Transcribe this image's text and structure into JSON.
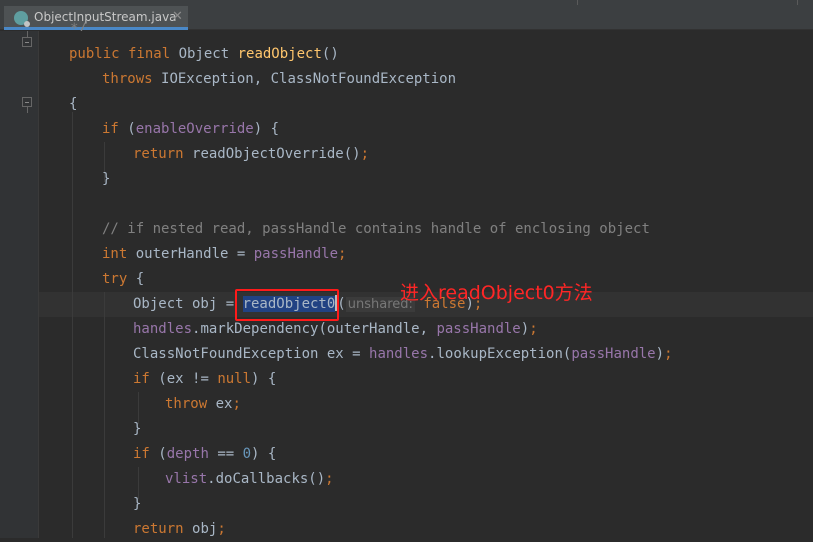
{
  "tab": {
    "label": "ObjectInputStream.java",
    "close": "✕",
    "icon": "java-class-icon"
  },
  "annotation": "进入readObject0方法",
  "code": {
    "l0": {
      "a": "*/"
    },
    "l1": {
      "kw1": "public final ",
      "type": "Object ",
      "fn": "readObject",
      "rest": "()"
    },
    "l2": {
      "kw": "throws ",
      "rest": "IOException, ClassNotFoundException"
    },
    "l3": {
      "rest": "{"
    },
    "l4": {
      "kw": "if ",
      "p1": "(",
      "fld": "enableOverride",
      "p2": ") {"
    },
    "l5": {
      "kw": "return ",
      "rest": "readObjectOverride()",
      "semi": ";"
    },
    "l6": {
      "rest": "}"
    },
    "l7": {
      "cm": "// if nested read, passHandle contains handle of enclosing object"
    },
    "l8": {
      "kw": "int ",
      "rest": "outerHandle = ",
      "fld": "passHandle",
      "semi": ";"
    },
    "l9": {
      "kw": "try ",
      "rest": "{"
    },
    "l10": {
      "a": "Object obj = ",
      "sel": "readObject0",
      "b": "(",
      "hint": "unshared:",
      "kw": " false",
      "c": ")",
      "semi": ";"
    },
    "l11": {
      "fld": "handles",
      "a": ".markDependency(outerHandle, ",
      "fld2": "passHandle",
      "b": ")",
      "semi": ";"
    },
    "l12": {
      "a": "ClassNotFoundException ex = ",
      "fld": "handles",
      "b": ".lookupException(",
      "fld2": "passHandle",
      "c": ")",
      "semi": ";"
    },
    "l13": {
      "kw": "if ",
      "a": "(ex != ",
      "kw2": "null",
      "b": ") {"
    },
    "l14": {
      "kw": "throw ",
      "a": "ex",
      "semi": ";"
    },
    "l15": {
      "rest": "}"
    },
    "l16": {
      "kw": "if ",
      "a": "(",
      "fld": "depth",
      "b": " == ",
      "num": "0",
      "c": ") {"
    },
    "l17": {
      "fld": "vlist",
      "a": ".doCallbacks()",
      "semi": ";"
    },
    "l18": {
      "rest": "}"
    },
    "l19": {
      "kw": "return ",
      "a": "obj",
      "semi": ";"
    }
  }
}
